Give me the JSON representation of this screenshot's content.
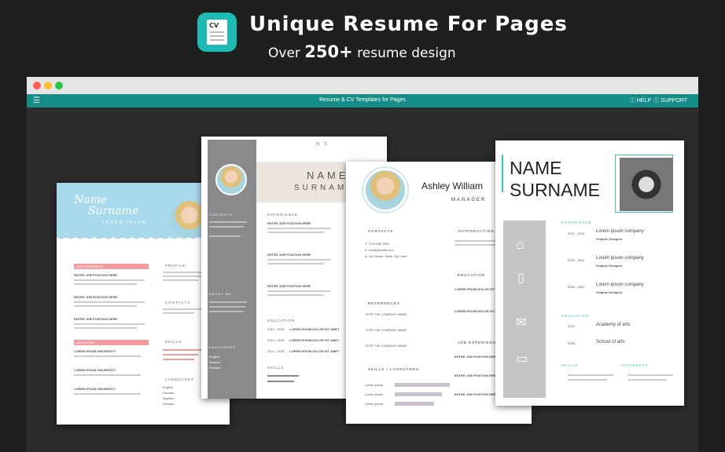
{
  "hero": {
    "icon_label": "CV",
    "title": "Unique Resume For Pages",
    "sub_prefix": "Over ",
    "sub_count": "250+",
    "sub_suffix": " resume design"
  },
  "window": {
    "title": "Resume & CV Templates for Pages",
    "help": "HELP",
    "support": "SUPPORT",
    "dots": [
      "#ff5f57",
      "#febc2e",
      "#28c840"
    ]
  },
  "r1": {
    "name": "Name",
    "surname": "Surname",
    "lorem": "LOREM IPSUM",
    "job_exp": "JOB EXPERIENCE",
    "profile": "PROFILE",
    "contacts": "CONTACTS",
    "skills": "SKILLS",
    "education": "EDUCATION",
    "languages": "LANGUAGES",
    "job1": "ENTER JOB POSITION HERE",
    "job2": "ENTER JOB POSITION HERE",
    "job3": "ENTER JOB POSITION HERE",
    "edu1": "LOREM IPSUM UNIVERSITY",
    "edu2": "LOREM IPSUM UNIVERSITY",
    "edu3": "LOREM IPSUM UNIVERSITY",
    "lang1": "English",
    "lang2": "German",
    "lang3": "Spanish",
    "lang4": "Russian"
  },
  "r2": {
    "ns": "N   S",
    "name": "NAME",
    "surname": "SURNAME",
    "contacts": "CONTACTS",
    "about": "ABOUT ME",
    "languages": "LANGUAGES",
    "experience": "EXPERIENCE",
    "education": "EDUCATION",
    "skills": "SKILLS",
    "job1": "ENTER JOB POSITION HERE",
    "job2": "ENTER JOB POSITION HERE",
    "job3": "ENTER JOB POSITION HERE",
    "edu1": "LOREM IPSUM DOLOR SIT AMET",
    "edu2": "LOREM IPSUM DOLOR SIT AMET",
    "edu3": "LOREM IPSUM DOLOR SIT AMET",
    "year1": "2014 - 2015",
    "year2": "2014 - 2015",
    "year3": "2014 - 2015",
    "lang1": "English",
    "lang2": "Spanish",
    "lang3": "Russian"
  },
  "r3": {
    "name": "Ashley William",
    "role": "MANAGER",
    "contacts": "CONTACTS",
    "introduction": "INTRODUCTION",
    "education": "EDUCATION",
    "references": "REFERENCES",
    "job_exp": "JOB EXPERIENCE",
    "skills": "SKILLS / LANGUAGES",
    "phone": "T: +123 456 7890",
    "email": "E: email@email.com",
    "addr": "A: 123 Street, State, Zip Code",
    "ref1": "TYPE THE COMPANY NAME",
    "ref2": "TYPE THE COMPANY NAME",
    "ref3": "TYPE THE COMPANY NAME",
    "edu1": "LOREM IPSUM DOLOR SIT AMET",
    "edu2": "LOREM IPSUM DOLOR SIT AMET",
    "job1": "ENTER JOB POSITION HERE",
    "job2": "ENTER JOB POSITION HERE",
    "job3": "ENTER JOB POSITION HERE",
    "skill": "Lorem ipsum"
  },
  "r4": {
    "name": "NAME",
    "surname": "SURNAME",
    "experience": "EXPERIENCE",
    "education": "EDUCATION",
    "skills": "SKILLS",
    "interests": "INTERESTS",
    "co1": "Lorem ipsum company",
    "co2": "Lorem ipsum company",
    "co3": "Lorem ipsum company",
    "role": "Graphic Designer",
    "y1": "2012 - 2015",
    "y2": "2009 - 2012",
    "y3": "2000 - 2001",
    "ed1": "Academy of arts",
    "ed2": "School of arts",
    "ey1": "2010",
    "ey2": "2008"
  }
}
